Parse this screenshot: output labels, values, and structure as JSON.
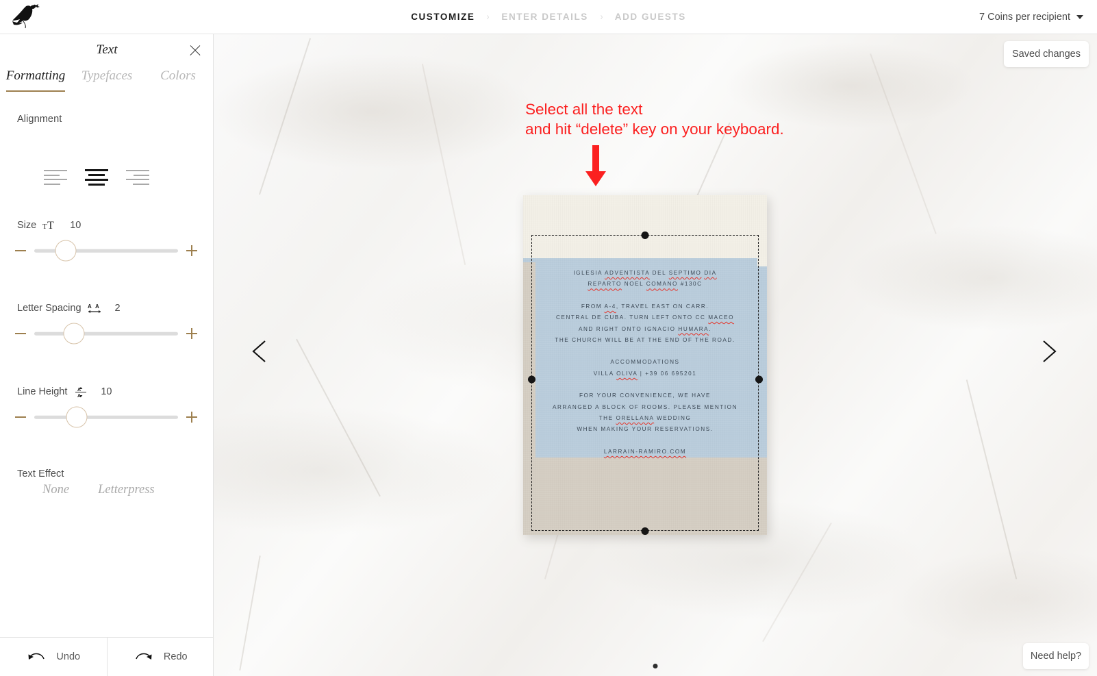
{
  "topbar": {
    "logo_icon": "bird-logo-icon",
    "steps": [
      {
        "label": "CUSTOMIZE",
        "active": true
      },
      {
        "label": "ENTER DETAILS",
        "active": false
      },
      {
        "label": "ADD GUESTS",
        "active": false
      }
    ],
    "separator": "›",
    "coins_label": "7 Coins per recipient",
    "coins_caret_icon": "chevron-down-icon"
  },
  "sidebar": {
    "title": "Text",
    "close_icon": "close-icon",
    "tabs": [
      {
        "label": "Formatting",
        "active": true
      },
      {
        "label": "Typefaces",
        "active": false
      },
      {
        "label": "Colors",
        "active": false
      }
    ],
    "alignment": {
      "label": "Alignment",
      "options": [
        {
          "name": "align-left",
          "active": false
        },
        {
          "name": "align-center",
          "active": true
        },
        {
          "name": "align-right",
          "active": false
        }
      ]
    },
    "size": {
      "label": "Size",
      "icon": "font-size-icon",
      "value": "10",
      "minus": "−",
      "plus": "+",
      "thumb_pct": 14
    },
    "letter_spacing": {
      "label": "Letter Spacing",
      "icon": "letter-spacing-icon",
      "value": "2",
      "minus": "−",
      "plus": "+",
      "thumb_pct": 21
    },
    "line_height": {
      "label": "Line Height",
      "icon": "line-height-icon",
      "value": "10",
      "minus": "−",
      "plus": "+",
      "thumb_pct": 24
    },
    "text_effect": {
      "label": "Text Effect",
      "options": [
        {
          "label": "None",
          "active": false
        },
        {
          "label": "Letterpress",
          "active": false
        }
      ]
    },
    "undo": {
      "label": "Undo",
      "icon": "undo-arrow-icon"
    },
    "redo": {
      "label": "Redo",
      "icon": "redo-arrow-icon"
    }
  },
  "canvas": {
    "saved_label": "Saved changes",
    "help_label": "Need help?",
    "prev_icon": "chevron-left-icon",
    "next_icon": "chevron-right-icon",
    "page_dot": "pagination-dot"
  },
  "annotation": {
    "line1": "Select all the text",
    "line2": "and hit “delete” key on your keyboard.",
    "color": "#fb2020",
    "arrow_icon": "down-arrow-icon"
  },
  "card": {
    "colors": {
      "cream": "#f2efe6",
      "blue": "#b9ccdb",
      "taupe": "#d4cdc2",
      "text": "#3d4a57"
    },
    "blocks": [
      {
        "lines": [
          {
            "parts": [
              {
                "t": "IGLESIA ",
                "sp": false
              },
              {
                "t": "ADVENTISTA",
                "sp": true
              },
              {
                "t": " DEL ",
                "sp": false
              },
              {
                "t": "SEPTIMO",
                "sp": true
              },
              {
                "t": " ",
                "sp": false
              },
              {
                "t": "DIA",
                "sp": true
              }
            ]
          },
          {
            "parts": [
              {
                "t": "REPARTO",
                "sp": true
              },
              {
                "t": " NOEL ",
                "sp": false
              },
              {
                "t": "COMANO",
                "sp": true
              },
              {
                "t": " #130C",
                "sp": false
              }
            ]
          }
        ]
      },
      {
        "lines": [
          {
            "parts": [
              {
                "t": "FROM ",
                "sp": false
              },
              {
                "t": "A-4",
                "sp": true
              },
              {
                "t": ", TRAVEL EAST ON CARR.",
                "sp": false
              }
            ]
          },
          {
            "parts": [
              {
                "t": "CENTRAL DE CUBA. TURN LEFT ONTO CC ",
                "sp": false
              },
              {
                "t": "MACEO",
                "sp": true
              }
            ]
          },
          {
            "parts": [
              {
                "t": "AND RIGHT ONTO IGNACIO ",
                "sp": false
              },
              {
                "t": "HUMARA",
                "sp": true
              },
              {
                "t": ".",
                "sp": false
              }
            ]
          },
          {
            "parts": [
              {
                "t": "THE CHURCH WILL BE AT THE END OF THE ROAD.",
                "sp": false
              }
            ]
          }
        ]
      },
      {
        "lines": [
          {
            "parts": [
              {
                "t": "ACCOMMODATIONS",
                "sp": false
              }
            ]
          },
          {
            "parts": [
              {
                "t": "VILLA ",
                "sp": false
              },
              {
                "t": "OLIVA",
                "sp": true
              },
              {
                "t": " | +39 06 695201",
                "sp": false
              }
            ]
          }
        ]
      },
      {
        "lines": [
          {
            "parts": [
              {
                "t": "FOR YOUR CONVENIENCE, WE HAVE",
                "sp": false
              }
            ]
          },
          {
            "parts": [
              {
                "t": "ARRANGED A BLOCK OF ROOMS. PLEASE MENTION",
                "sp": false
              }
            ]
          },
          {
            "parts": [
              {
                "t": "THE ",
                "sp": false
              },
              {
                "t": "ORELLANA",
                "sp": true
              },
              {
                "t": " WEDDING",
                "sp": false
              }
            ]
          },
          {
            "parts": [
              {
                "t": "WHEN MAKING YOUR RESERVATIONS.",
                "sp": false
              }
            ]
          }
        ]
      },
      {
        "lines": [
          {
            "parts": [
              {
                "t": "LARRAIN-RAMIRO.COM",
                "sp": true
              }
            ]
          }
        ]
      }
    ]
  }
}
